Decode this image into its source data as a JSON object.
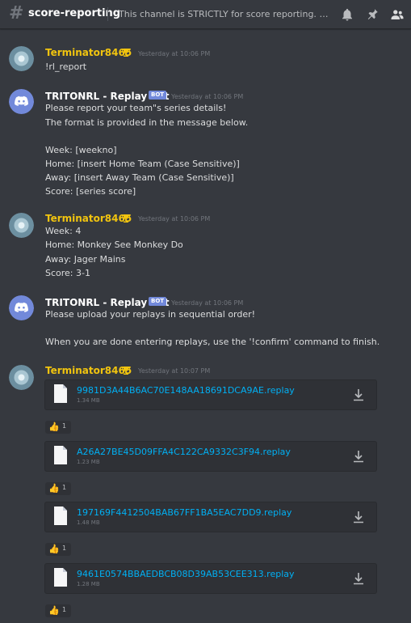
{
  "header": {
    "channel_name": "score-reporting",
    "topic": "This channel is STRICTLY for score reporting. Any chat..."
  },
  "icons": {
    "channel": "hashtag-icon",
    "notifications": "bell-icon",
    "pins": "pin-icon",
    "members": "members-icon"
  },
  "colors": {
    "background": "#36393f",
    "username_user": "#f1c40f",
    "link": "#00b0f4",
    "bot_tag": "#7289da"
  },
  "messages": [
    {
      "author": "Terminator8465",
      "timestamp": "Yesterday at 10:06 PM",
      "lines": [
        "!rl_report"
      ]
    },
    {
      "author": "TRITONRL - Replay Bot",
      "bot_tag": "BOT",
      "timestamp": "Yesterday at 10:06 PM",
      "lines": [
        "Please report your team\"s series details!",
        "The format is provided in the message below.",
        "Week: [weekno]",
        "Home: [insert Home Team (Case Sensitive)]",
        "Away: [insert Away Team (Case Sensitive)]",
        "Score: [series score]"
      ]
    },
    {
      "author": "Terminator8465",
      "timestamp": "Yesterday at 10:06 PM",
      "lines": [
        "Week: 4",
        "Home: Monkey See Monkey Do",
        "Away: Jager Mains",
        "Score: 3-1"
      ]
    },
    {
      "author": "TRITONRL - Replay Bot",
      "bot_tag": "BOT",
      "timestamp": "Yesterday at 10:06 PM",
      "lines": [
        "Please upload your replays in sequential order!",
        "When you are done entering replays, use the '!confirm' command to finish."
      ]
    },
    {
      "author": "Terminator8465",
      "timestamp": "Yesterday at 10:07 PM",
      "attachments": [
        {
          "filename": "9981D3A44B6AC70E148AA18691DCA9AE.replay",
          "size": "1.34 MB",
          "reaction_emoji": "👍",
          "reaction_count": "1"
        },
        {
          "filename": "A26A27BE45D09FFA4C122CA9332C3F94.replay",
          "size": "1.23 MB",
          "reaction_emoji": "👍",
          "reaction_count": "1"
        },
        {
          "filename": "197169F4412504BAB67FF1BA5EAC7DD9.replay",
          "size": "1.48 MB",
          "reaction_emoji": "👍",
          "reaction_count": "1"
        },
        {
          "filename": "9461E0574BBAEDBCB08D39AB53CEE313.replay",
          "size": "1.28 MB",
          "reaction_emoji": "👍",
          "reaction_count": "1"
        }
      ]
    }
  ]
}
